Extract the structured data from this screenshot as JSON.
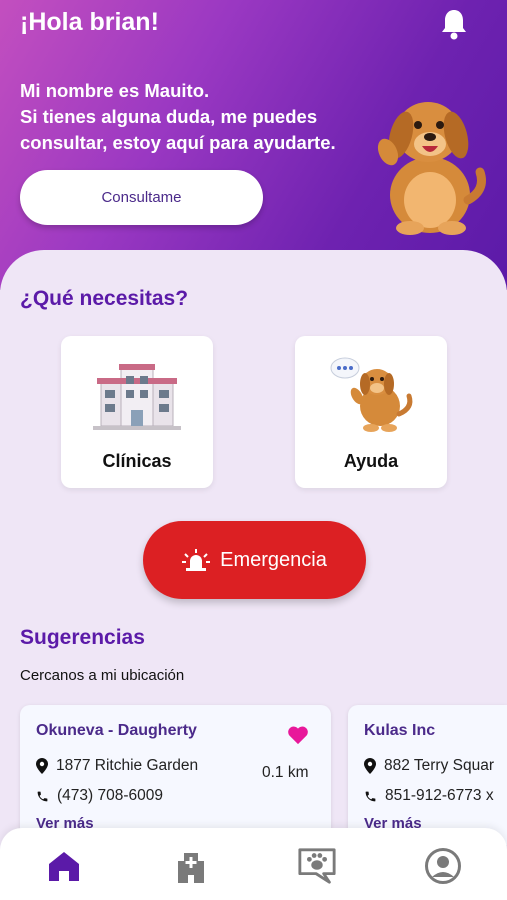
{
  "header": {
    "greeting": "¡Hola brian!",
    "intro_lines": [
      "Mi nombre es Mauito.",
      "Si tienes alguna duda, me puedes",
      "consultar, estoy aquí para ayudarte."
    ],
    "consult_label": "Consultame"
  },
  "needs": {
    "title": "¿Qué necesitas?",
    "cards": [
      {
        "label": "Clínicas",
        "icon": "clinic-building-icon"
      },
      {
        "label": "Ayuda",
        "icon": "help-dog-icon"
      }
    ]
  },
  "emergency": {
    "label": "Emergencia",
    "icon": "alarm-siren-icon"
  },
  "suggestions": {
    "title": "Sugerencias",
    "subtitle": "Cercanos a mi ubicación",
    "items": [
      {
        "name": "Okuneva - Daugherty",
        "address": "1877 Ritchie Garden",
        "distance": "0.1 km",
        "phone": "(473) 708-6009",
        "more": "Ver más",
        "favorite": true
      },
      {
        "name": "Kulas Inc",
        "address": "882 Terry Squar",
        "phone": "851-912-6773 x",
        "more": "Ver más"
      }
    ]
  },
  "nav": {
    "items": [
      "home-icon",
      "clinic-icon",
      "chat-pet-icon",
      "profile-icon"
    ],
    "active_color": "#5b1aa8",
    "inactive_color": "#7a7a7a"
  },
  "colors": {
    "brand": "#5b1aa8",
    "emergency": "#dc2023",
    "heart": "#e8189a"
  }
}
